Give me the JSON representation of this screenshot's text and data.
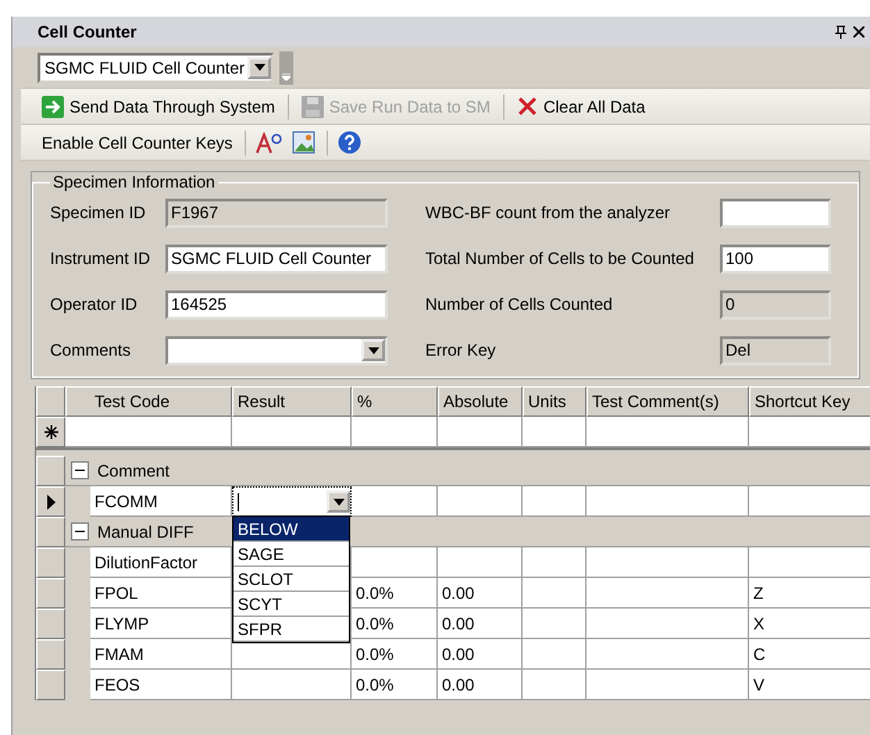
{
  "window": {
    "title": "Cell Counter"
  },
  "counter_select": {
    "value": "SGMC FLUID Cell Counter"
  },
  "toolbar": [
    {
      "kind": "send",
      "label": "Send Data Through System",
      "disabled": false
    },
    {
      "kind": "save",
      "label": "Save Run Data to SM",
      "disabled": true
    },
    {
      "kind": "clear",
      "label": "Clear All Data",
      "disabled": false
    }
  ],
  "toolbar2": {
    "label": "Enable Cell Counter Keys",
    "icons": [
      {
        "kind": "font"
      },
      {
        "kind": "image"
      },
      {
        "kind": "help"
      }
    ]
  },
  "specimen": {
    "legend": "Specimen Information",
    "left": [
      {
        "label": "Specimen ID",
        "value": "F1967",
        "kind": "text",
        "readonly": true
      },
      {
        "label": "Instrument ID",
        "value": "SGMC FLUID Cell Counter",
        "kind": "text",
        "readonly": false
      },
      {
        "label": "Operator ID",
        "value": "164525",
        "kind": "text",
        "readonly": false
      },
      {
        "label": "Comments",
        "kind": "combo",
        "readonly": false
      }
    ],
    "right": [
      {
        "label": "WBC-BF count from the analyzer",
        "kind": "text",
        "readonly": false
      },
      {
        "label": "Total Number of Cells to be Counted",
        "value": "100",
        "kind": "text",
        "readonly": false
      },
      {
        "label": "Number of Cells Counted",
        "value": "0",
        "kind": "text",
        "readonly": true
      },
      {
        "label": "Error Key",
        "value": "Del",
        "kind": "text",
        "readonly": true
      }
    ]
  },
  "grid": {
    "columns": [
      "Test Code",
      "Result",
      "%",
      "Absolute",
      "Units",
      "Test Comment(s)",
      "Shortcut Key"
    ],
    "groups": [
      {
        "name": "Comment",
        "expanded": true,
        "rows": [
          {
            "cells": [
              "FCOMM",
              "",
              "",
              "",
              "",
              "",
              ""
            ],
            "current": true,
            "dropdown": {
              "options": [
                {
                  "label": "BELOW",
                  "selected": true
                },
                {
                  "label": "SAGE",
                  "selected": false
                },
                {
                  "label": "SCLOT",
                  "selected": false
                },
                {
                  "label": "SCYT",
                  "selected": false
                },
                {
                  "label": "SFPR",
                  "selected": false
                }
              ]
            }
          }
        ]
      },
      {
        "name": "Manual DIFF",
        "expanded": true,
        "rows": [
          {
            "cells": [
              "DilutionFactor",
              "",
              "",
              "",
              "",
              "",
              ""
            ],
            "current": false
          },
          {
            "cells": [
              "FPOL",
              "",
              "0.0%",
              "0.00",
              "",
              "",
              "Z"
            ],
            "current": false
          },
          {
            "cells": [
              "FLYMP",
              "",
              "0.0%",
              "0.00",
              "",
              "",
              "X"
            ],
            "current": false
          },
          {
            "cells": [
              "FMAM",
              "",
              "0.0%",
              "0.00",
              "",
              "",
              "C"
            ],
            "current": false
          },
          {
            "cells": [
              "FEOS",
              "",
              "0.0%",
              "0.00",
              "",
              "",
              "V"
            ],
            "current": false
          }
        ]
      }
    ]
  }
}
